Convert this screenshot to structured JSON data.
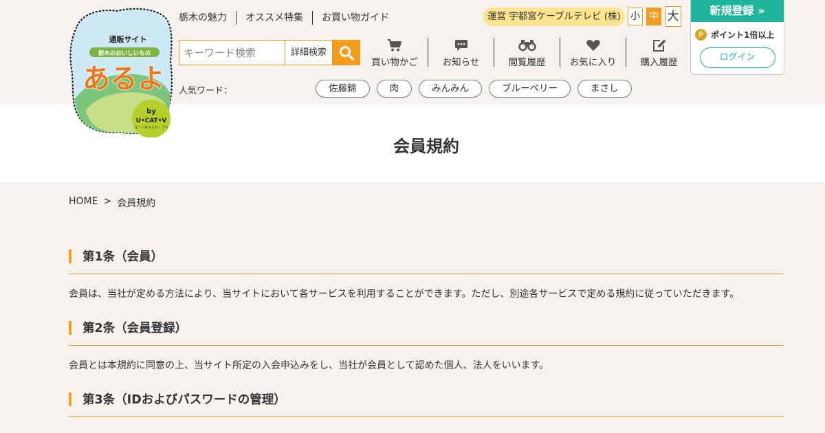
{
  "colors": {
    "accent": "#f39c1e",
    "register": "#1eb59a",
    "operator_bg": "#fde58f",
    "point": "#d9a424"
  },
  "logo": {
    "line1": "通販サイト",
    "line2": "栃木のおいしいもの",
    "name": "あるよ",
    "by": "by",
    "brand": "U•CAT•V",
    "brand_sub": "ユー・キャット・ブイ"
  },
  "topnav": [
    "栃木の魅力",
    "オススメ特集",
    "お買い物ガイド"
  ],
  "operator": "運営 宇都宮ケーブルテレビ (株)",
  "fontsize": {
    "small": "小",
    "medium": "中",
    "large": "大",
    "selected": "中"
  },
  "account": {
    "register": "新規登録 »",
    "point_icon": "P",
    "points": "ポイント1倍以上",
    "login": "ログイン"
  },
  "search": {
    "placeholder": "キーワード検索",
    "advanced": "詳細検索",
    "button_icon": "search-icon"
  },
  "iconmenu": [
    {
      "label": "買い物かご",
      "icon": "cart-icon"
    },
    {
      "label": "お知らせ",
      "icon": "chat-icon"
    },
    {
      "label": "閲覧履歴",
      "icon": "binoculars-icon"
    },
    {
      "label": "お気に入り",
      "icon": "heart-icon"
    },
    {
      "label": "購入履歴",
      "icon": "edit-icon"
    }
  ],
  "popular": {
    "label": "人気ワード：",
    "tags": [
      "佐藤錦",
      "肉",
      "みんみん",
      "ブルーベリー",
      "まさし"
    ]
  },
  "page_title": "会員規約",
  "breadcrumb": {
    "home": "HOME",
    "sep": ">",
    "current": "会員規約"
  },
  "articles": [
    {
      "title": "第1条（会員）",
      "body": "会員は、当社が定める方法により、当サイトにおいて各サービスを利用することができます。ただし、別途各サービスで定める規約に従っていただきます。"
    },
    {
      "title": "第2条（会員登録）",
      "body": "会員とは本規約に同意の上、当サイト所定の入会申込みをし、当社が会員として認めた個人、法人をいいます。"
    },
    {
      "title": "第3条（IDおよびパスワードの管理）",
      "body": ""
    }
  ]
}
